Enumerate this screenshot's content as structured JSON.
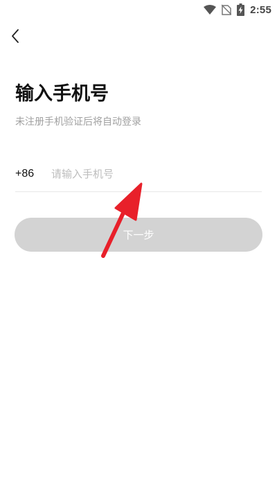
{
  "status_bar": {
    "time": "2:55",
    "icons": [
      "wifi-icon",
      "no-sim-icon",
      "battery-charging-icon"
    ]
  },
  "header": {
    "back_icon": "chevron-left-icon"
  },
  "main": {
    "title": "输入手机号",
    "subtitle": "未注册手机验证后将自动登录",
    "phone": {
      "country_code": "+86",
      "value": "",
      "placeholder": "请输入手机号"
    },
    "next_button_label": "下一步"
  },
  "colors": {
    "button_disabled": "#d3d3d3",
    "subtitle_text": "#a0a0a0",
    "placeholder_text": "#bdbdbd",
    "annotation_arrow": "#e8202a"
  }
}
